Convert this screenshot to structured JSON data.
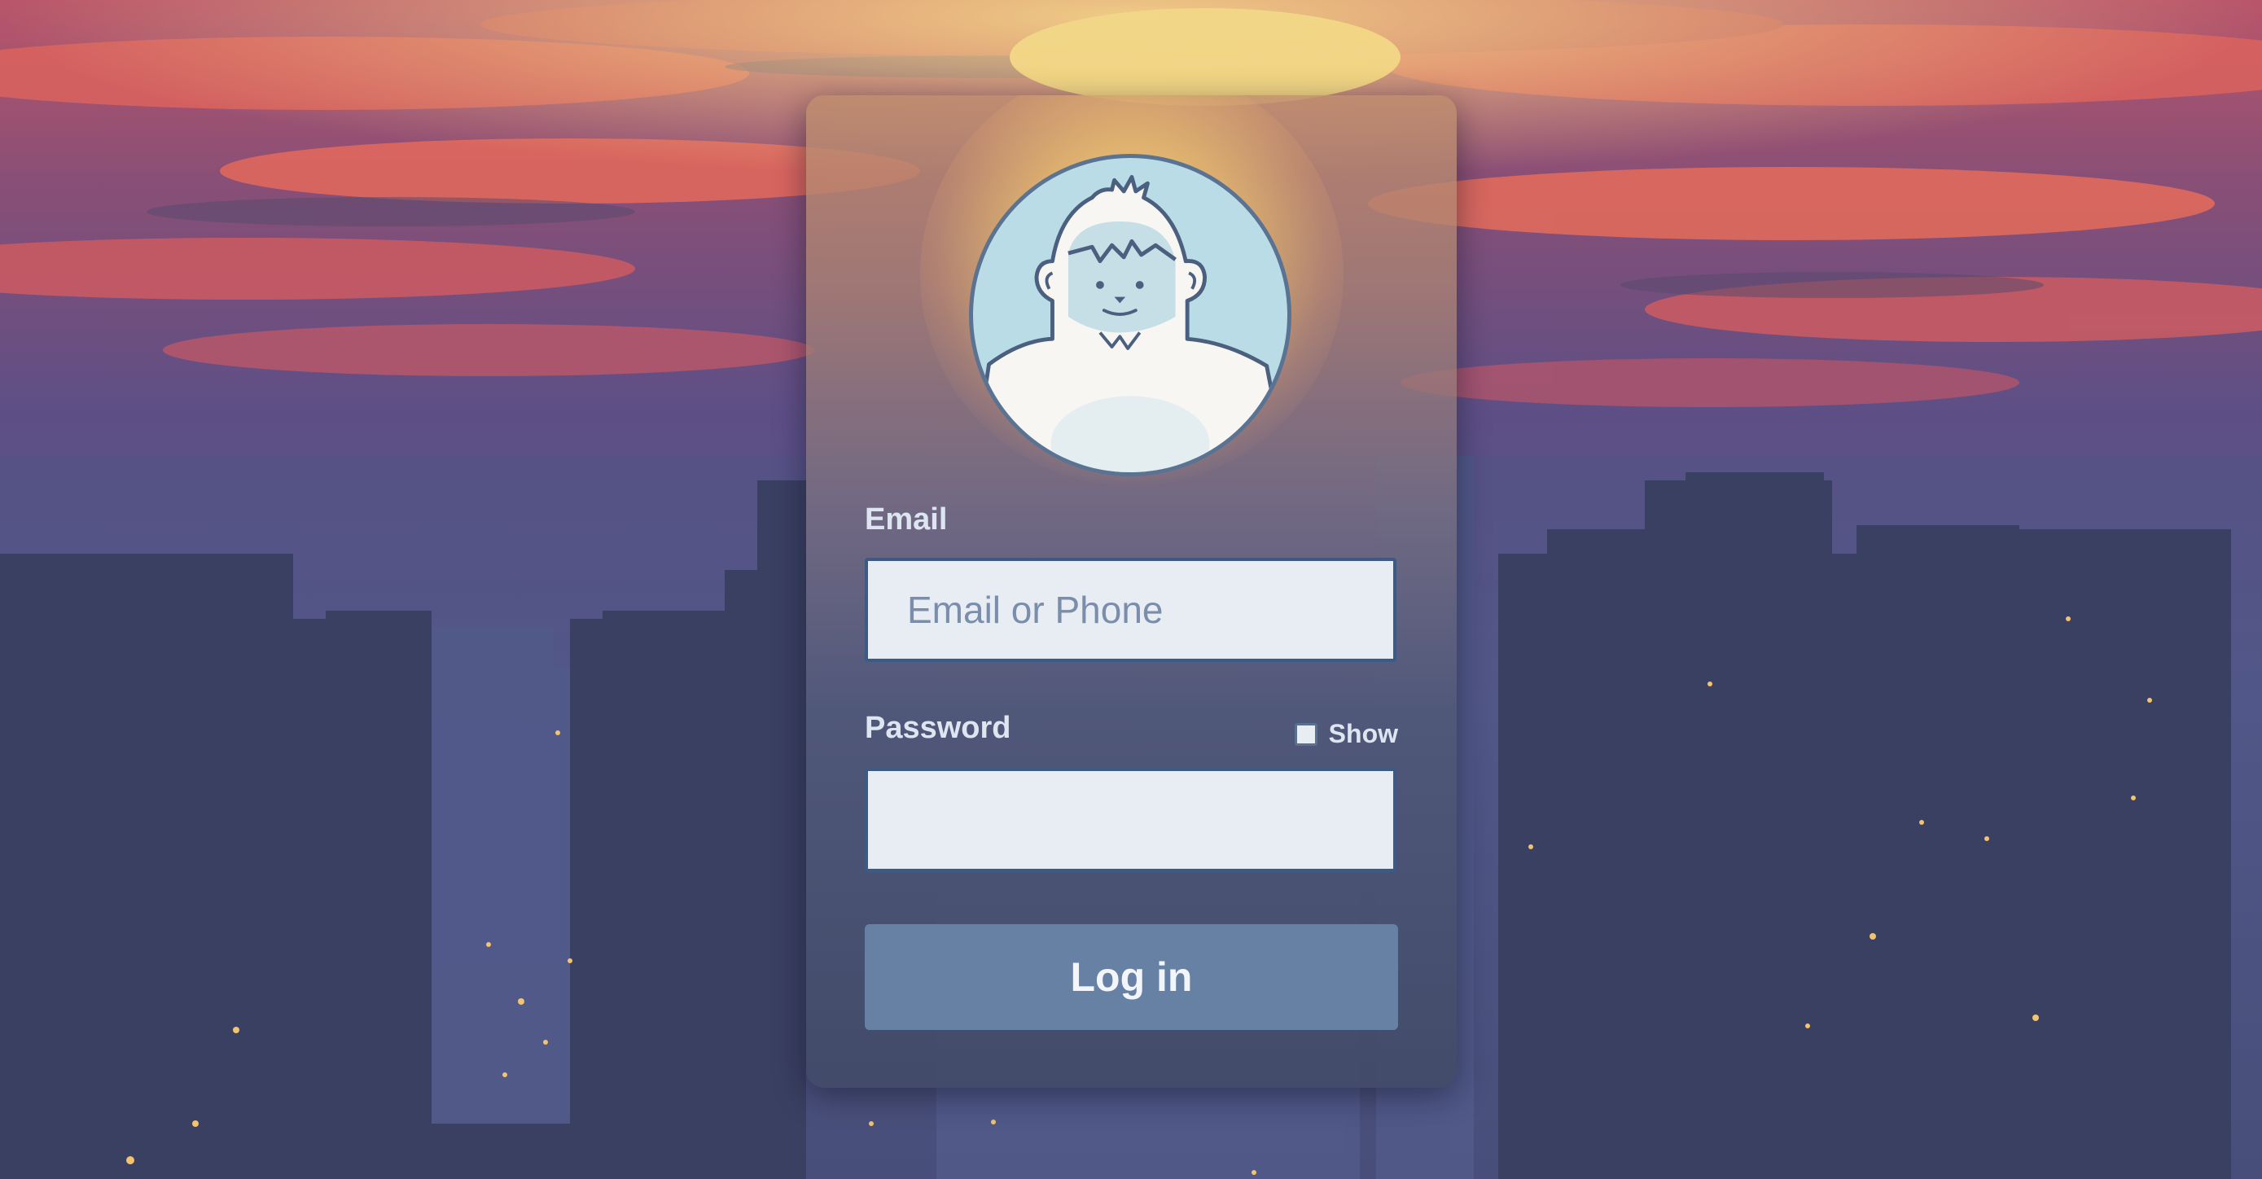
{
  "login": {
    "email_label": "Email",
    "email_placeholder": "Email or Phone",
    "password_label": "Password",
    "show_label": "Show",
    "submit_label": "Log in"
  },
  "icons": {
    "avatar": "yeti-avatar-icon"
  },
  "colors": {
    "button": "#6781a5",
    "field_border": "#3b5a86",
    "label": "#dde5f1",
    "avatar_bg": "#b9dce6"
  }
}
